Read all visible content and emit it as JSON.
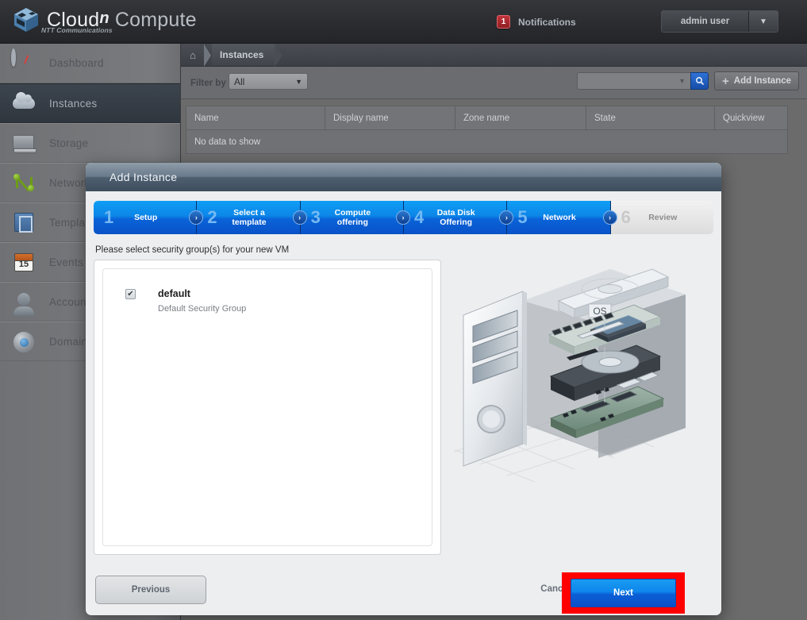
{
  "header": {
    "logo_cloud": "Cloud",
    "logo_sup": "n",
    "logo_compute": "Compute",
    "logo_sub": "NTT Communications",
    "notifications_count": "1",
    "notifications_label": "Notifications",
    "user_name": "admin user",
    "user_caret": "▼"
  },
  "sidebar": {
    "items": [
      {
        "label": "Dashboard",
        "icon": "gauge-icon"
      },
      {
        "label": "Instances",
        "icon": "cloud-icon"
      },
      {
        "label": "Storage",
        "icon": "disk-icon"
      },
      {
        "label": "Network",
        "icon": "network-nodes-icon"
      },
      {
        "label": "Templates",
        "icon": "template-icon"
      },
      {
        "label": "Events",
        "icon": "calendar-icon"
      },
      {
        "label": "Accounts",
        "icon": "user-icon"
      },
      {
        "label": "Domains",
        "icon": "globe-icon"
      }
    ],
    "calendar_day": "15"
  },
  "breadcrumb": {
    "home_icon": "⌂",
    "current": "Instances"
  },
  "toolbar": {
    "filter_label": "Filter by",
    "filter_value": "All",
    "filter_caret": "▼",
    "search_value": "",
    "search_placeholder": "",
    "search_caret": "▼",
    "search_icon": "⌕",
    "add_instance_label": "Add Instance",
    "add_plus": "+"
  },
  "table": {
    "columns": [
      "Name",
      "Display name",
      "Zone name",
      "State",
      "Quickview"
    ],
    "empty_message": "No data to show"
  },
  "modal": {
    "title": "Add Instance",
    "steps": [
      {
        "num": "1",
        "label": "Setup",
        "active": true
      },
      {
        "num": "2",
        "label": "Select a template",
        "active": true
      },
      {
        "num": "3",
        "label": "Compute offering",
        "active": true
      },
      {
        "num": "4",
        "label": "Data Disk Offering",
        "active": true
      },
      {
        "num": "5",
        "label": "Network",
        "active": true
      },
      {
        "num": "6",
        "label": "Review",
        "active": false
      }
    ],
    "step_chevron": "›",
    "prompt": "Please select security group(s) for your new VM",
    "security_groups": [
      {
        "name": "default",
        "description": "Default Security Group",
        "checked": true
      }
    ],
    "check_glyph": "✔",
    "illustration_label": "OS",
    "previous_label": "Previous",
    "cancel_label": "Cancel",
    "next_label": "Next",
    "highlight_color": "#ff0000"
  }
}
